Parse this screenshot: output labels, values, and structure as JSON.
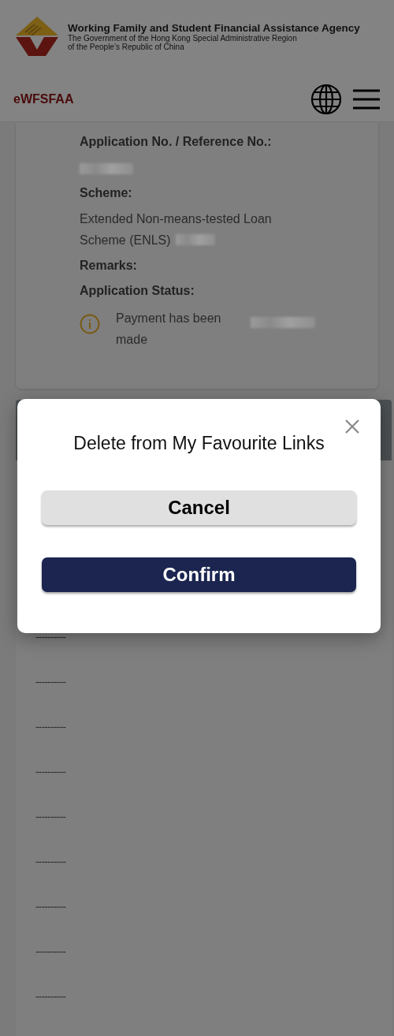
{
  "header": {
    "agency_name": "Working Family and Student Financial Assistance Agency",
    "government_lines": [
      "The Government of the Hong Kong Special Administrative Region",
      "of the People’s Republic of China"
    ]
  },
  "navbar": {
    "brand": "eWFSFAA"
  },
  "application": {
    "fields": [
      {
        "label": "Application No. / Reference No.:",
        "redacted": true
      },
      {
        "label": "Scheme:",
        "value": "Extended Non-means-tested Loan Scheme (ENLS)",
        "redacted": true
      },
      {
        "label": "Remarks:",
        "redacted": false
      }
    ],
    "status": {
      "label": "Application Status:",
      "text": "Payment has been made",
      "redacted": true
    }
  },
  "links": [
    "----------",
    "----------",
    "----------",
    "----------",
    "----------",
    "----------",
    "----------",
    "----------",
    "----------"
  ],
  "dialog": {
    "title": "Delete from My Favourite Links",
    "buttons": [
      {
        "label": "Cancel",
        "kind": "secondary"
      },
      {
        "label": "Confirm",
        "kind": "primary"
      }
    ]
  }
}
